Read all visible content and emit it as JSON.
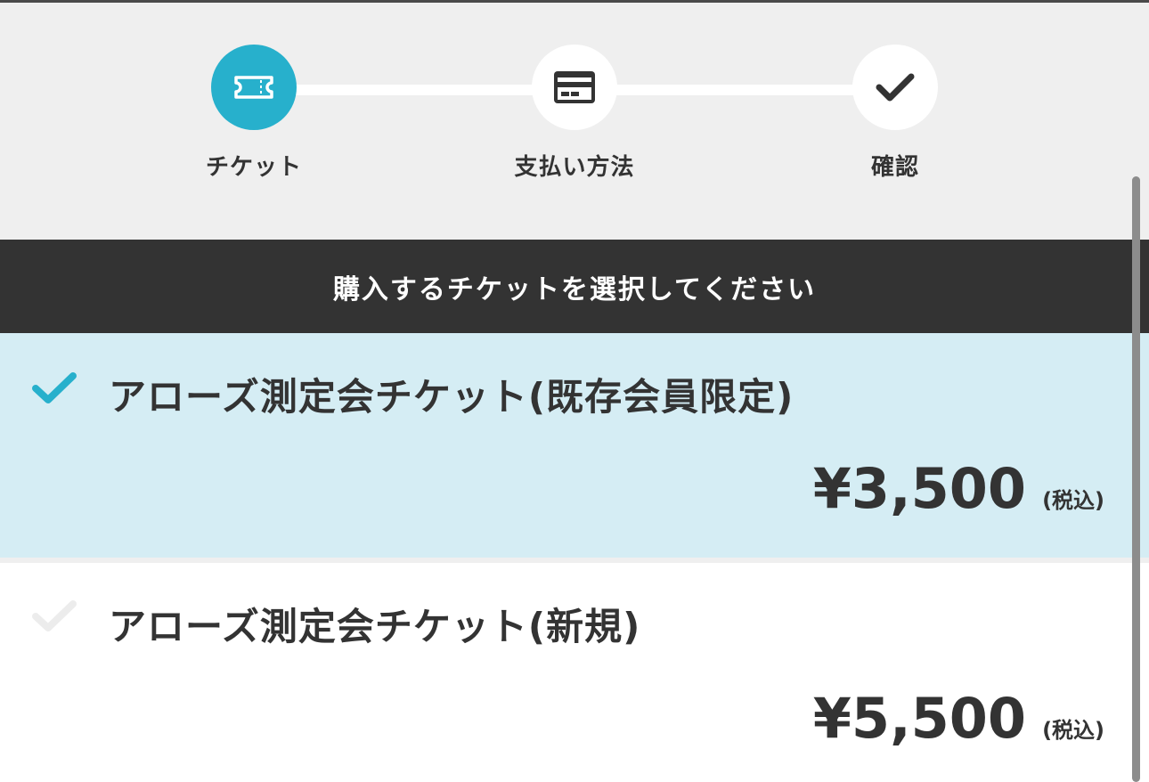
{
  "stepper": {
    "steps": [
      {
        "label": "チケット",
        "icon": "ticket-icon",
        "state": "active"
      },
      {
        "label": "支払い方法",
        "icon": "credit-card-icon",
        "state": "inactive"
      },
      {
        "label": "確認",
        "icon": "checkmark-icon",
        "state": "inactive"
      }
    ]
  },
  "banner": {
    "text": "購入するチケットを選択してください"
  },
  "tickets": [
    {
      "name": "アローズ測定会チケット(既存会員限定)",
      "price": "¥3,500",
      "tax_note": "(税込)",
      "selected": true
    },
    {
      "name": "アローズ測定会チケット(新規)",
      "price": "¥5,500",
      "tax_note": "(税込)",
      "selected": false
    }
  ],
  "colors": {
    "accent": "#27b0cc",
    "selected_bg": "#d5edf4",
    "banner_bg": "#333333",
    "page_bg": "#efefef"
  }
}
